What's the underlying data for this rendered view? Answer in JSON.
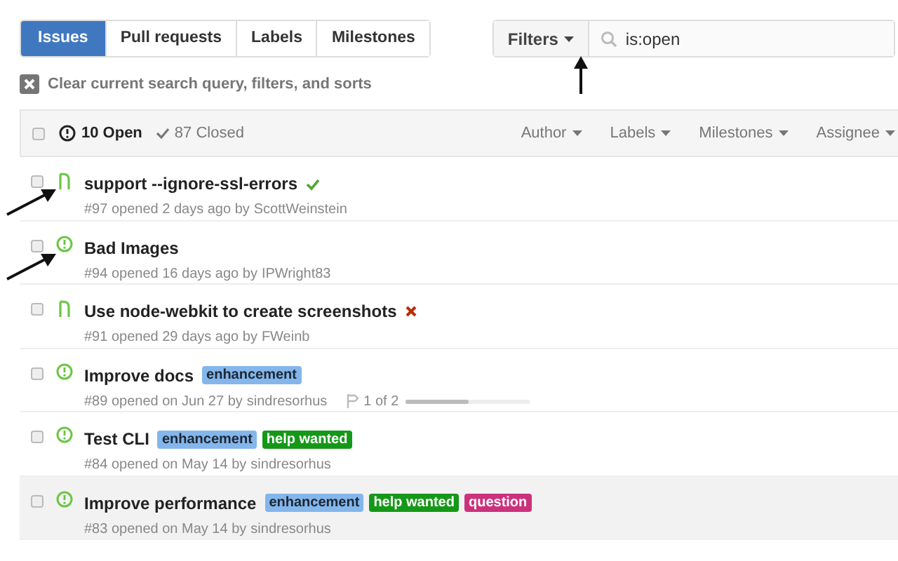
{
  "tabs": [
    {
      "label": "Issues",
      "selected": true
    },
    {
      "label": "Pull requests",
      "selected": false
    },
    {
      "label": "Labels",
      "selected": false
    },
    {
      "label": "Milestones",
      "selected": false
    }
  ],
  "filters_button": "Filters",
  "search": {
    "value": "is:open"
  },
  "clear_filters": "Clear current search query, filters, and sorts",
  "header": {
    "checked": false,
    "open_count": "10 Open",
    "closed_count": "87 Closed",
    "filters": [
      "Author",
      "Labels",
      "Milestones",
      "Assignee"
    ]
  },
  "issues": [
    {
      "kind": "pull",
      "checked": false,
      "title": "support --ignore-ssl-errors",
      "check": {
        "kind": "success"
      },
      "meta": "#97 opened 2 days ago by",
      "author": "ScottWeinstein",
      "highlighted": false
    },
    {
      "kind": "issue",
      "checked": false,
      "title": "Bad Images",
      "meta": "#94 opened 16 days ago by",
      "author": "IPWright83",
      "highlighted": false
    },
    {
      "kind": "pull",
      "checked": false,
      "title": "Use node-webkit to create screenshots",
      "check": {
        "kind": "failure"
      },
      "meta": "#91 opened 29 days ago by",
      "author": "FWeinb",
      "highlighted": false
    },
    {
      "kind": "issue",
      "checked": false,
      "title": "Improve docs",
      "meta": "#89 opened on Jun 27 by",
      "author": "sindresorhus",
      "labels": [
        {
          "text": "enhancement",
          "color": "#84b6eb"
        }
      ],
      "milestone": {
        "text": "1 of 2",
        "level": 0.5
      },
      "highlighted": false
    },
    {
      "kind": "issue",
      "checked": false,
      "title": "Test CLI",
      "meta": "#84 opened on May 14 by",
      "author": "sindresorhus",
      "labels": [
        {
          "text": "enhancement",
          "color": "#84b6eb"
        },
        {
          "text": "help wanted",
          "color": "#159818"
        }
      ],
      "highlighted": false
    },
    {
      "kind": "issue",
      "checked": false,
      "title": "Improve performance",
      "meta": "#83 opened on May 14 by",
      "author": "sindresorhus",
      "labels": [
        {
          "text": "enhancement",
          "color": "#84b6eb"
        },
        {
          "text": "help wanted",
          "color": "#159818"
        },
        {
          "text": "question",
          "color": "#cc317c"
        }
      ],
      "highlighted": true
    }
  ]
}
